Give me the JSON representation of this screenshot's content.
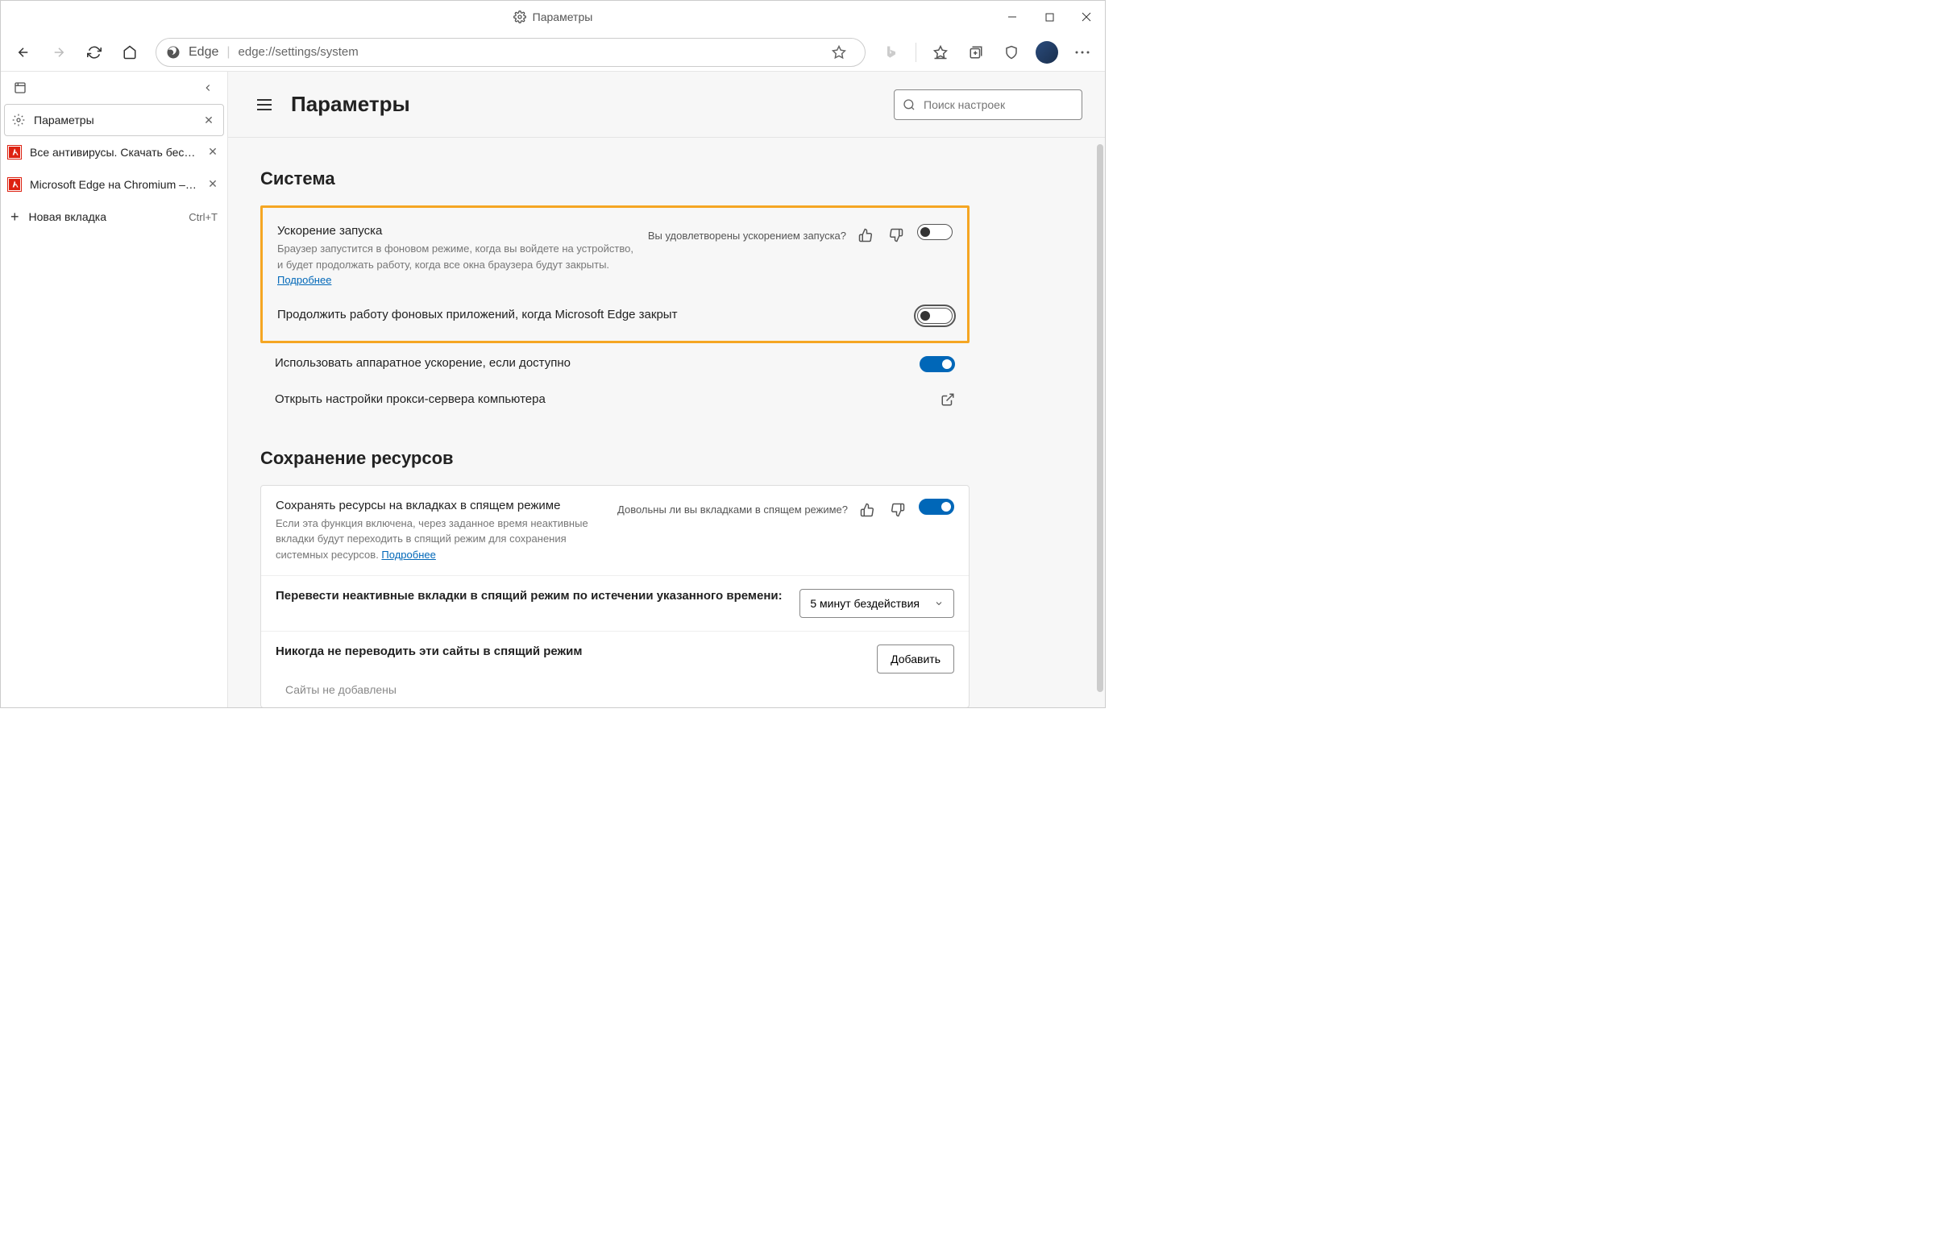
{
  "titlebar": {
    "title": "Параметры"
  },
  "toolbar": {
    "addr_brand": "Edge",
    "addr_url": "edge://settings/system"
  },
  "sidebar": {
    "tabs": [
      {
        "label": "Параметры"
      },
      {
        "label": "Все антивирусы. Скачать беспл…"
      },
      {
        "label": "Microsoft Edge на Chromium – Н…"
      }
    ],
    "new_tab": "Новая вкладка",
    "shortcut": "Ctrl+T"
  },
  "header": {
    "title": "Параметры",
    "search_placeholder": "Поиск настроек"
  },
  "section1": {
    "title": "Система",
    "startup_boost": {
      "label": "Ускорение запуска",
      "desc1": "Браузер запустится в фоновом режиме, когда вы войдете на устройство, и будет продолжать работу, когда все окна браузера будут закрыты. ",
      "more": "Подробнее",
      "feedback_q": "Вы удовлетворены ускорением запуска?"
    },
    "bg_apps": {
      "label": "Продолжить работу фоновых приложений, когда Microsoft Edge закрыт"
    },
    "hw_accel": {
      "label": "Использовать аппаратное ускорение, если доступно"
    },
    "proxy": {
      "label": "Открыть настройки прокси-сервера компьютера"
    }
  },
  "section2": {
    "title": "Сохранение ресурсов",
    "sleeping_tabs": {
      "label": "Сохранять ресурсы на вкладках в спящем режиме",
      "desc1": "Если эта функция включена, через заданное время неактивные вкладки будут переходить в спящий режим для сохранения системных ресурсов. ",
      "more": "Подробнее",
      "feedback_q": "Довольны ли вы вкладками в спящем режиме?"
    },
    "timeout": {
      "label": "Перевести неактивные вкладки в спящий режим по истечении указанного времени:",
      "value": "5 минут бездействия"
    },
    "never": {
      "label": "Никогда не переводить эти сайты в спящий режим",
      "add": "Добавить",
      "empty": "Сайты не добавлены"
    }
  }
}
